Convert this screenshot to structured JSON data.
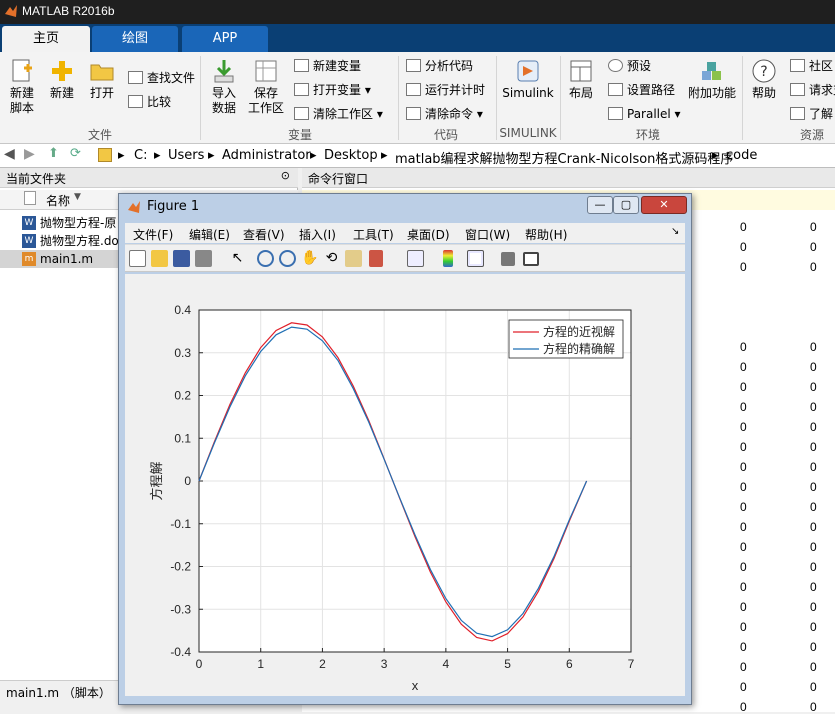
{
  "app": {
    "title": "MATLAB R2016b"
  },
  "tabs": [
    "主页",
    "绘图",
    "APP"
  ],
  "ribbon": {
    "new_script": "新建\n脚本",
    "new": "新建",
    "open": "打开",
    "find_files": "查找文件",
    "compare": "比较",
    "import_data": "导入\n数据",
    "save_workspace": "保存\n工作区",
    "new_variable": "新建变量",
    "open_variable": "打开变量",
    "clear_workspace": "清除工作区",
    "analyze_code": "分析代码",
    "run_and_time": "运行并计时",
    "clear_commands": "清除命令",
    "simulink": "Simulink",
    "layout": "布局",
    "preferences": "预设",
    "set_path": "设置路径",
    "parallel": "Parallel",
    "addons": "附加功能",
    "help": "帮助",
    "community": "社区",
    "request_support": "请求支",
    "learn": "了解",
    "groups": {
      "file": "文件",
      "variable": "变量",
      "code": "代码",
      "simulink": "SIMULINK",
      "environment": "环境",
      "resources": "资源"
    }
  },
  "address": {
    "drive": "C:",
    "segments": [
      "Users",
      "Administrator",
      "Desktop",
      "matlab编程求解抛物型方程Crank-Nicolson格式源码程序",
      "code"
    ]
  },
  "current_folder": {
    "title": "当前文件夹",
    "column_name": "名称",
    "files": [
      "抛物型方程-原",
      "抛物型方程.do",
      "main1.m"
    ],
    "status": "main1.m （脚本）"
  },
  "command_window": {
    "title": "命令行窗口",
    "zero_text": "0"
  },
  "figure": {
    "title": "Figure 1",
    "menu": [
      "文件(F)",
      "编辑(E)",
      "查看(V)",
      "插入(I)",
      "工具(T)",
      "桌面(D)",
      "窗口(W)",
      "帮助(H)"
    ]
  },
  "chart_data": {
    "type": "line",
    "title": "",
    "xlabel": "x",
    "ylabel": "方程解",
    "xlim": [
      0,
      7
    ],
    "ylim": [
      -0.4,
      0.4
    ],
    "xticks": [
      0,
      1,
      2,
      3,
      4,
      5,
      6,
      7
    ],
    "yticks": [
      0.4,
      0.3,
      0.2,
      0.1,
      0,
      -0.1,
      -0.2,
      -0.3,
      -0.4
    ],
    "grid": true,
    "legend_position": "top-right",
    "x": [
      0,
      0.25,
      0.5,
      0.75,
      1.0,
      1.25,
      1.5,
      1.75,
      2.0,
      2.25,
      2.5,
      2.75,
      3.0,
      3.25,
      3.5,
      3.75,
      4.0,
      4.25,
      4.5,
      4.75,
      5.0,
      5.25,
      5.5,
      5.75,
      6.0,
      6.28
    ],
    "series": [
      {
        "name": "方程的近视解",
        "color": "#e0202a",
        "values": [
          0,
          0.092,
          0.179,
          0.253,
          0.312,
          0.352,
          0.37,
          0.365,
          0.337,
          0.289,
          0.222,
          0.142,
          0.052,
          -0.04,
          -0.13,
          -0.213,
          -0.283,
          -0.335,
          -0.366,
          -0.374,
          -0.357,
          -0.318,
          -0.258,
          -0.182,
          -0.094,
          0
        ]
      },
      {
        "name": "方程的精确解",
        "color": "#1f6fb4",
        "values": [
          0,
          0.089,
          0.173,
          0.246,
          0.303,
          0.342,
          0.36,
          0.355,
          0.328,
          0.282,
          0.216,
          0.138,
          0.051,
          -0.039,
          -0.126,
          -0.207,
          -0.275,
          -0.326,
          -0.356,
          -0.364,
          -0.348,
          -0.31,
          -0.251,
          -0.177,
          -0.091,
          0
        ]
      }
    ]
  }
}
